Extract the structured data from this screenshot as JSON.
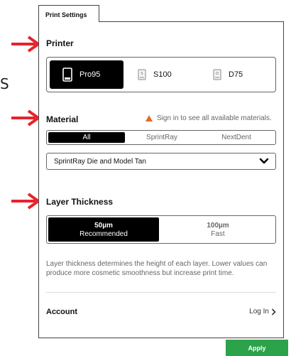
{
  "stray_text": "S",
  "tab": {
    "label": "Print Settings"
  },
  "printer": {
    "title": "Printer",
    "options": [
      {
        "label": "Pro95",
        "selected": true
      },
      {
        "label": "S100",
        "selected": false
      },
      {
        "label": "D75",
        "selected": false
      }
    ],
    "icon_letters": {
      "s100": "S",
      "d75": "D"
    }
  },
  "material": {
    "title": "Material",
    "warning": "Sign in to see all available materials.",
    "tabs": [
      {
        "label": "All",
        "selected": true
      },
      {
        "label": "SprintRay",
        "selected": false
      },
      {
        "label": "NextDent",
        "selected": false
      }
    ],
    "selected_material": "SprintRay Die and Model Tan"
  },
  "layer": {
    "title": "Layer Thickness",
    "options": [
      {
        "value": "50µm",
        "desc": "Recommended",
        "selected": true
      },
      {
        "value": "100µm",
        "desc": "Fast",
        "selected": false
      }
    ],
    "help": "Layer thickness determines the height of each layer. Lower values can produce more cosmetic smoothness but increase print time."
  },
  "account": {
    "label": "Account",
    "login": "Log In"
  },
  "apply_label": "Apply",
  "colors": {
    "accent": "#2ca24b",
    "arrow": "#e8222b",
    "warning": "#e86a1f",
    "selected": "#000000"
  }
}
